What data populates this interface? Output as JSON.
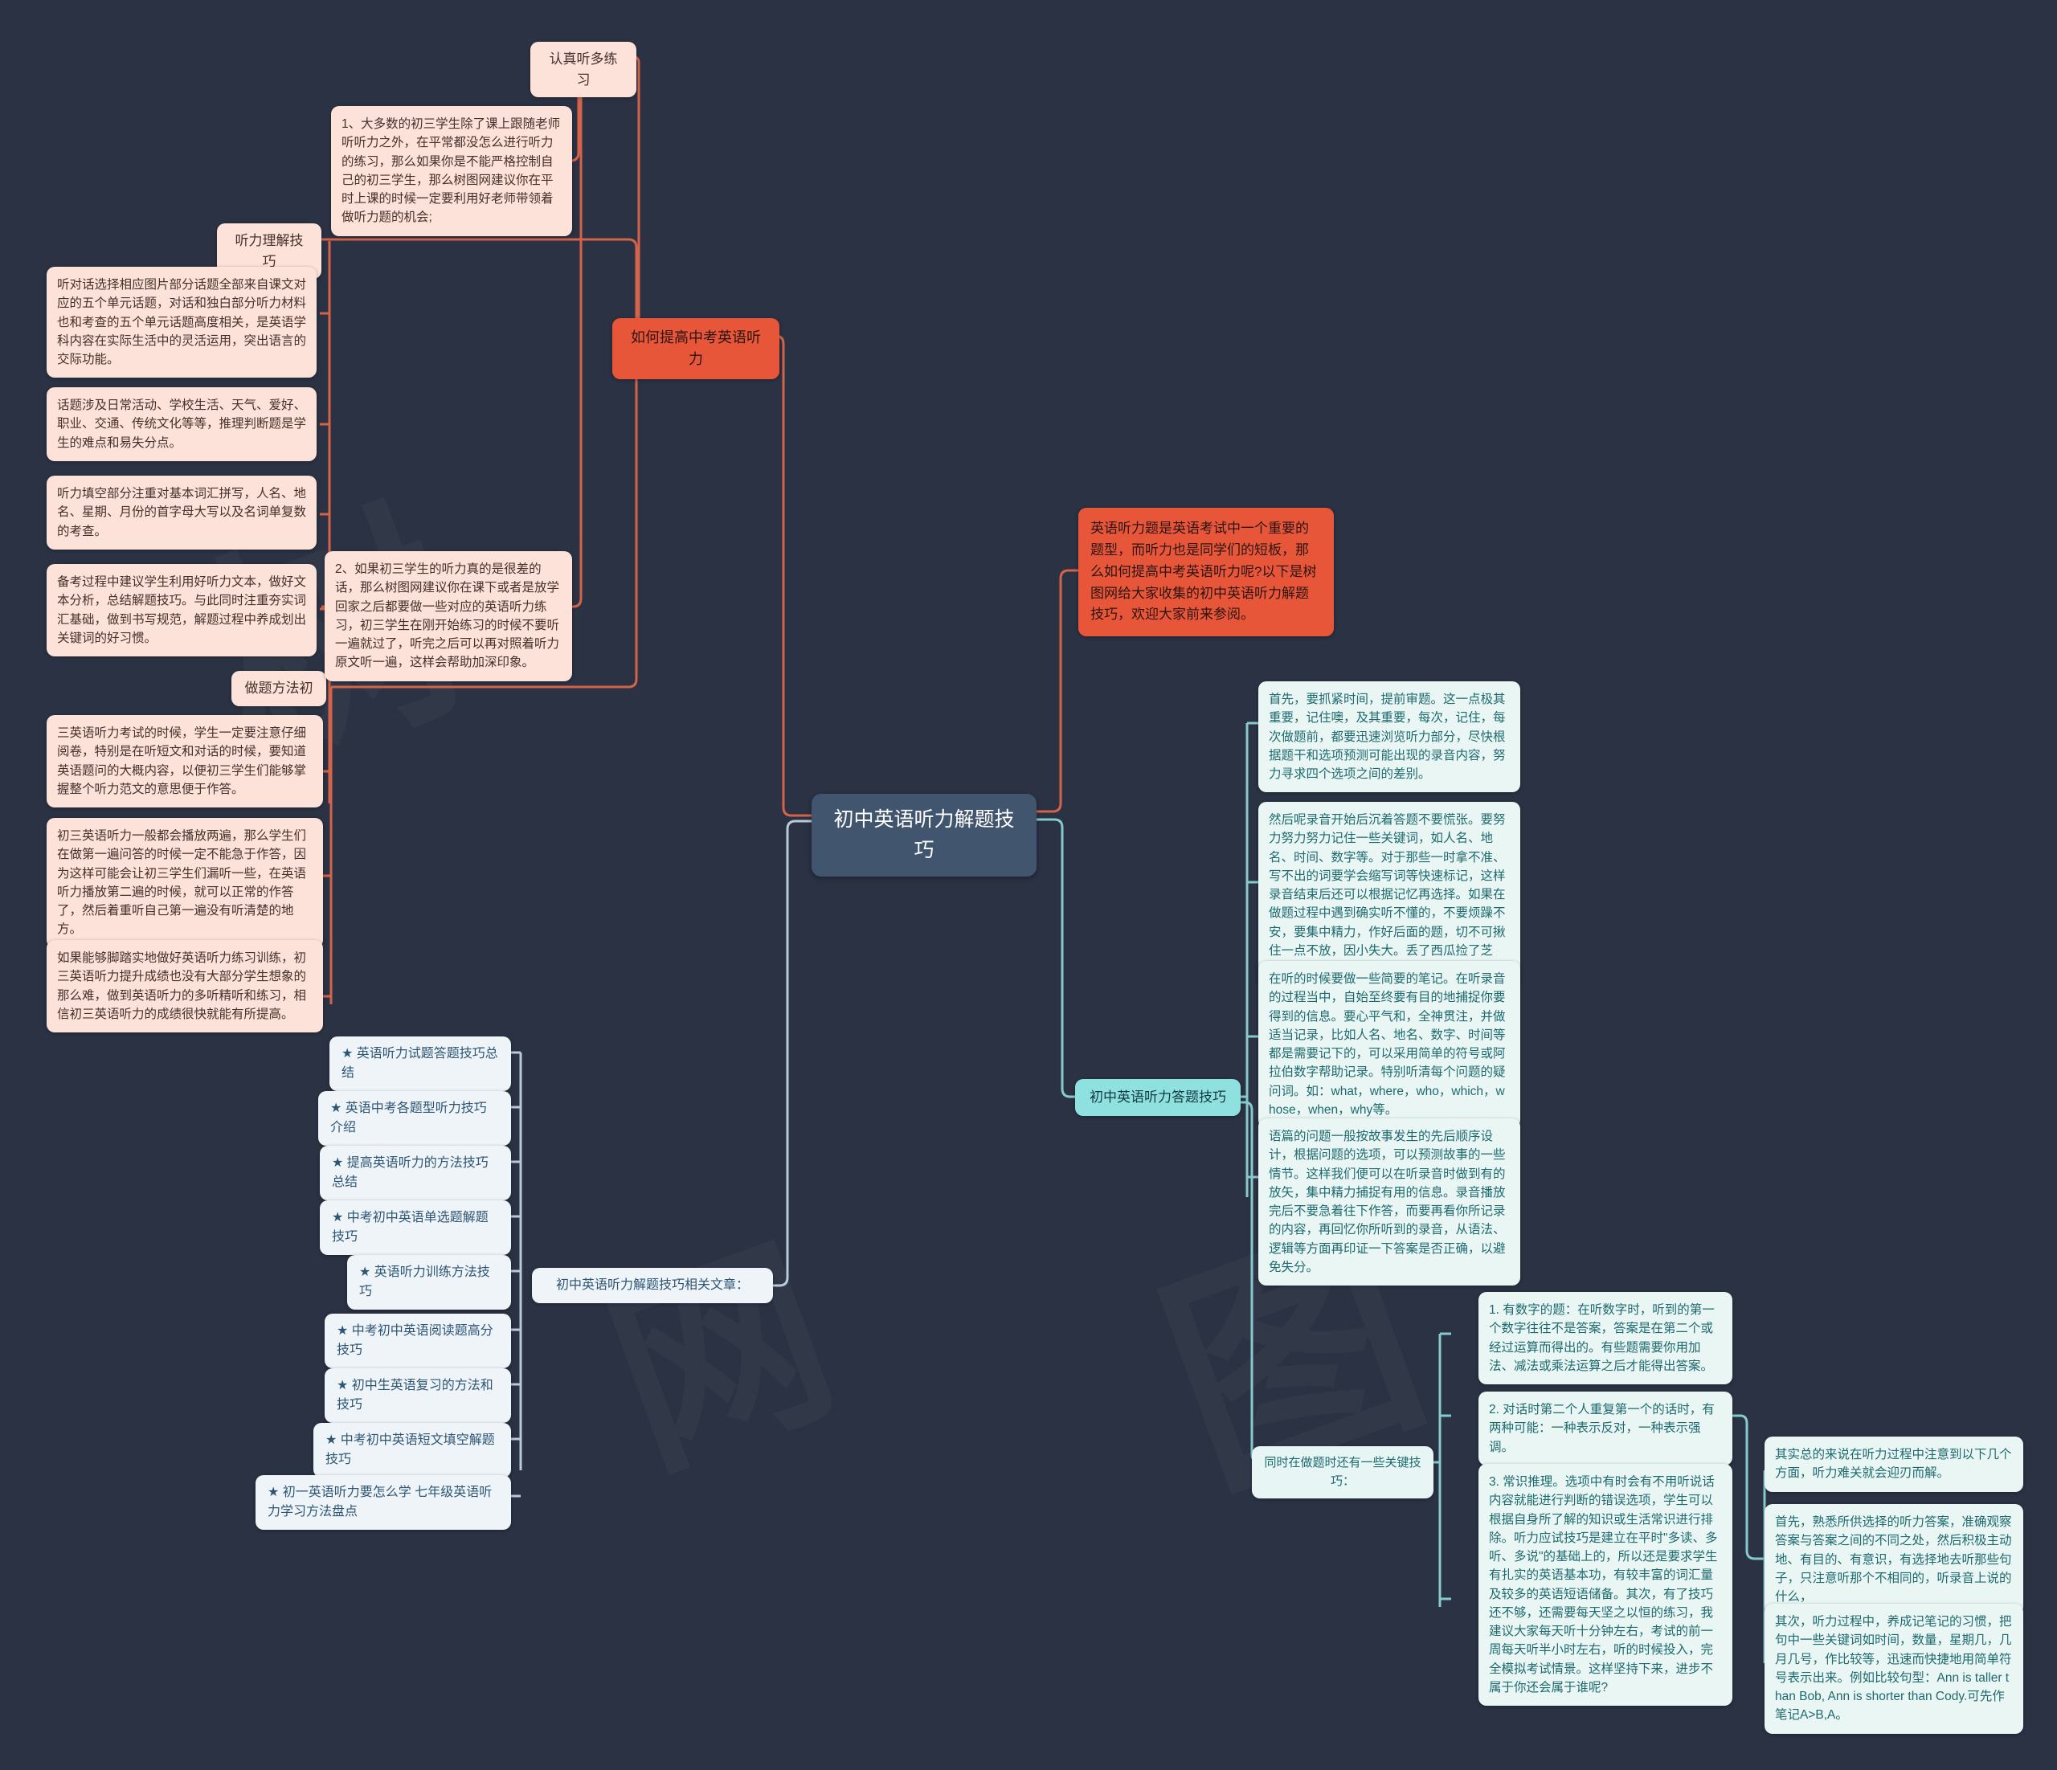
{
  "root": {
    "title": "初中英语听力解题技巧"
  },
  "left_branch": {
    "label": "如何提高中考英语听力",
    "groups": [
      {
        "label": "认真听多练习",
        "items": [
          "1、大多数的初三学生除了课上跟随老师听听力之外，在平常都没怎么进行听力的练习，那么如果你是不能严格控制自己的初三学生，那么树图网建议你在平时上课的时候一定要利用好老师带领着做听力题的机会;"
        ]
      },
      {
        "label": "听力理解技巧",
        "items": [
          "听对话选择相应图片部分话题全部来自课文对应的五个单元话题，对话和独白部分听力材料也和考查的五个单元话题高度相关，是英语学科内容在实际生活中的灵活运用，突出语言的交际功能。",
          "话题涉及日常活动、学校生活、天气、爱好、职业、交通、传统文化等等，推理判断题是学生的难点和易失分点。",
          "听力填空部分注重对基本词汇拼写，人名、地名、星期、月份的首字母大写以及名词单复数的考查。",
          "备考过程中建议学生利用好听力文本，做好文本分析，总结解题技巧。与此同时注重夯实词汇基础，做到书写规范，解题过程中养成划出关键词的好习惯。"
        ]
      },
      {
        "label": "做题方法初",
        "items": [
          "2、如果初三学生的听力真的是很差的话，那么树图网建议你在课下或者是放学回家之后都要做一些对应的英语听力练习，初三学生在刚开始练习的时候不要听一遍就过了，听完之后可以再对照着听力原文听一遍，这样会帮助加深印象。",
          "三英语听力考试的时候，学生一定要注意仔细阅卷，特别是在听短文和对话的时候，要知道英语题问的大概内容，以便初三学生们能够掌握整个听力范文的意思便于作答。",
          "初三英语听力一般都会播放两遍，那么学生们在做第一遍问答的时候一定不能急于作答，因为这样可能会让初三学生们漏听一些，在英语听力播放第二遍的时候，就可以正常的作答了，然后着重听自己第一遍没有听清楚的地方。",
          "如果能够脚踏实地做好英语听力练习训练，初三英语听力提升成绩也没有大部分学生想象的那么难，做到英语听力的多听精听和练习，相信初三英语听力的成绩很快就能有所提高。"
        ]
      }
    ]
  },
  "related": {
    "label": "初中英语听力解题技巧相关文章：",
    "items": [
      "★ 英语听力试题答题技巧总结",
      "★ 英语中考各题型听力技巧介绍",
      "★ 提高英语听力的方法技巧总结",
      "★ 中考初中英语单选题解题技巧",
      "★ 英语听力训练方法技巧",
      "★ 中考初中英语阅读题高分技巧",
      "★ 初中生英语复习的方法和技巧",
      "★ 中考初中英语短文填空解题技巧",
      "★ 初一英语听力要怎么学 七年级英语听力学习方法盘点"
    ]
  },
  "right_branch": {
    "intro": "英语听力题是英语考试中一个重要的题型，而听力也是同学们的短板，那么如何提高中考英语听力呢?以下是树图网给大家收集的初中英语听力解题技巧，欢迎大家前来参阅。",
    "label": "初中英语听力答题技巧",
    "items": [
      "首先，要抓紧时间，提前审题。这一点极其重要，记住噢，及其重要，每次，记住，每次做题前，都要迅速浏览听力部分，尽快根据题干和选项预测可能出现的录音内容，努力寻求四个选项之间的差别。",
      "然后呢录音开始后沉着答题不要慌张。要努力努力努力记住一些关键词，如人名、地名、时间、数字等。对于那些一时拿不准、写不出的词要学会缩写词等快速标记，这样录音结束后还可以根据记忆再选择。如果在做题过程中遇到确实听不懂的，不要烦躁不安，要集中精力，作好后面的题，切不可揪住一点不放，因小失大。丢了西瓜捡了芝麻。",
      "在听的时候要做一些简要的笔记。在听录音的过程当中，自始至终要有目的地捕捉你要得到的信息。要心平气和，全神贯注，并做适当记录，比如人名、地名、数字、时间等都是需要记下的，可以采用简单的符号或阿拉伯数字帮助记录。特别听清每个问题的疑问词。如：what，where，who，which，whose，when，why等。",
      "语篇的问题一般按故事发生的先后顺序设计，根据问题的选项，可以预测故事的一些情节。这样我们便可以在听录音时做到有的放矢，集中精力捕捉有用的信息。录音播放完后不要急着往下作答，而要再看你所记录的内容，再回忆你所听到的录音，从语法、逻辑等方面再印证一下答案是否正确，以避免失分。"
    ],
    "tips_label": "同时在做题时还有一些关键技巧：",
    "tips": [
      "1. 有数字的题：在听数字时，听到的第一个数字往往不是答案，答案是在第二个或经过运算而得出的。有些题需要你用加法、减法或乘法运算之后才能得出答案。",
      "2. 对话时第二个人重复第一个的话时，有两种可能：一种表示反对，一种表示强调。",
      "3. 常识推理。选项中有时会有不用听说话内容就能进行判断的错误选项，学生可以根据自身所了解的知识或生活常识进行排除。听力应试技巧是建立在平时\"多读、多听、多说\"的基础上的，所以还是要求学生有扎实的英语基本功，有较丰富的词汇量及较多的英语短语储备。其次，有了技巧还不够，还需要每天坚之以恒的练习，我建议大家每天听十分钟左右，考试的前一周每天听半小时左右，听的时候投入，完全模拟考试情景。这样坚持下来，进步不属于你还会属于谁呢?"
    ],
    "summary_items": [
      "其实总的来说在听力过程中注意到以下几个方面，听力难关就会迎刃而解。",
      "首先，熟悉所供选择的听力答案，准确观察答案与答案之间的不同之处，然后积极主动地、有目的、有意识，有选择地去听那些句子，只注意听那个不相同的，听录音上说的什么，",
      "其次，听力过程中，养成记笔记的习惯，把句中一些关键词如时间，数量，星期几，几月几号，作比较等，迅速而快捷地用简单符号表示出来。例如比较句型：Ann is taller than Bob, Ann is shorter than Cody.可先作笔记A>B,A。"
    ]
  },
  "colors": {
    "background": "#2a3243",
    "root": "#42556f",
    "peach": "#fce2d8",
    "orange": "#e8563a",
    "teal_light": "#eaf6f4",
    "teal_accent": "#8fe1e0",
    "article": "#eef4f8",
    "link_orange": "#d4634b",
    "link_teal": "#86c9ce",
    "link_blue": "#b9cbd8"
  }
}
